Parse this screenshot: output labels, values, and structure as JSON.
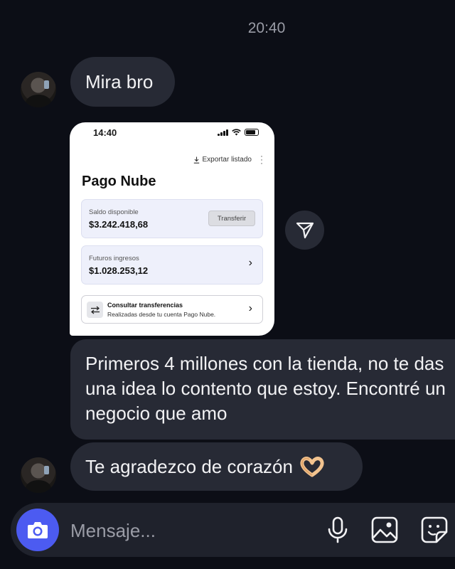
{
  "thread": {
    "timestamp": "20:40",
    "messages": [
      {
        "text": "Mira bro"
      },
      {
        "text": "Primeros 4 millones con la tienda, no te das una idea lo contento que estoy. Encontré un negocio que amo"
      },
      {
        "text": "Te agradezco de corazón",
        "emoji": "heart-hands"
      }
    ]
  },
  "shared_screenshot": {
    "status_time": "14:40",
    "export_label": "Exportar listado",
    "brand": "Pago Nube",
    "saldo": {
      "label": "Saldo disponible",
      "amount": "$3.242.418,68",
      "button": "Transferir"
    },
    "futuros": {
      "label": "Futuros ingresos",
      "amount": "$1.028.253,12"
    },
    "consultar": {
      "title": "Consultar transferencias",
      "subtitle": "Realizadas desde tu cuenta Pago Nube."
    }
  },
  "composer": {
    "placeholder": "Mensaje..."
  },
  "colors": {
    "background": "#0c0e16",
    "bubble": "#272a35",
    "camera_button": "#4c5bf1",
    "timestamp": "#9a9ca6"
  },
  "icons": [
    "camera-icon",
    "microphone-icon",
    "gallery-icon",
    "sticker-icon",
    "share-icon",
    "heart-hands-emoji"
  ]
}
